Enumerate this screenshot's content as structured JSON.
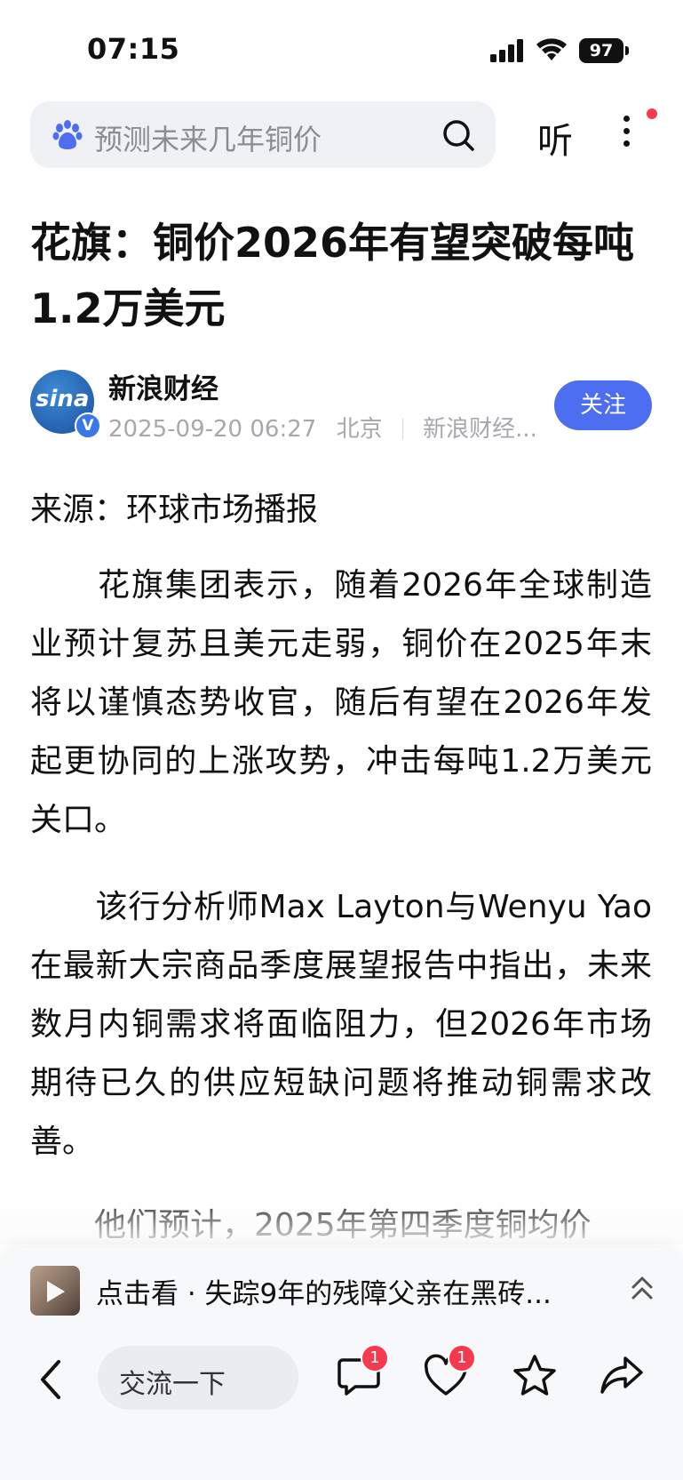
{
  "status_bar": {
    "time": "07:15",
    "battery": "97"
  },
  "search": {
    "placeholder": "预测未来几年铜价"
  },
  "header": {
    "listen_label": "听"
  },
  "article": {
    "title": "花旗：铜价2026年有望突破每吨1.2万美元",
    "author": "新浪财经",
    "avatar_text": "sina",
    "datetime": "2025-09-20 06:27",
    "location": "北京",
    "publisher": "新浪财经...",
    "follow_label": "关注",
    "source": "来源：环球市场播报",
    "paragraphs": [
      "　　花旗集团表示，随着2026年全球制造业预计复苏且美元走弱，铜价在2025年末将以谨慎态势收官，随后有望在2026年发起更协同的上涨攻势，冲击每吨1.2万美元关口。",
      "　　该行分析师Max Layton与Wenyu Yao在最新大宗商品季度展望报告中指出，未来数月内铜需求将面临阻力，但2026年市场期待已久的供应短缺问题将推动铜需求改善。",
      "　　他们预计，2025年第四季度铜均价"
    ]
  },
  "recommend": {
    "text": "点击看 · 失踪9年的残障父亲在黑砖..."
  },
  "bottom_bar": {
    "comment_placeholder": "交流一下",
    "comment_count": "1",
    "like_count": "1"
  },
  "colors": {
    "accent": "#4e6ef2",
    "badge": "#f53a4f"
  }
}
